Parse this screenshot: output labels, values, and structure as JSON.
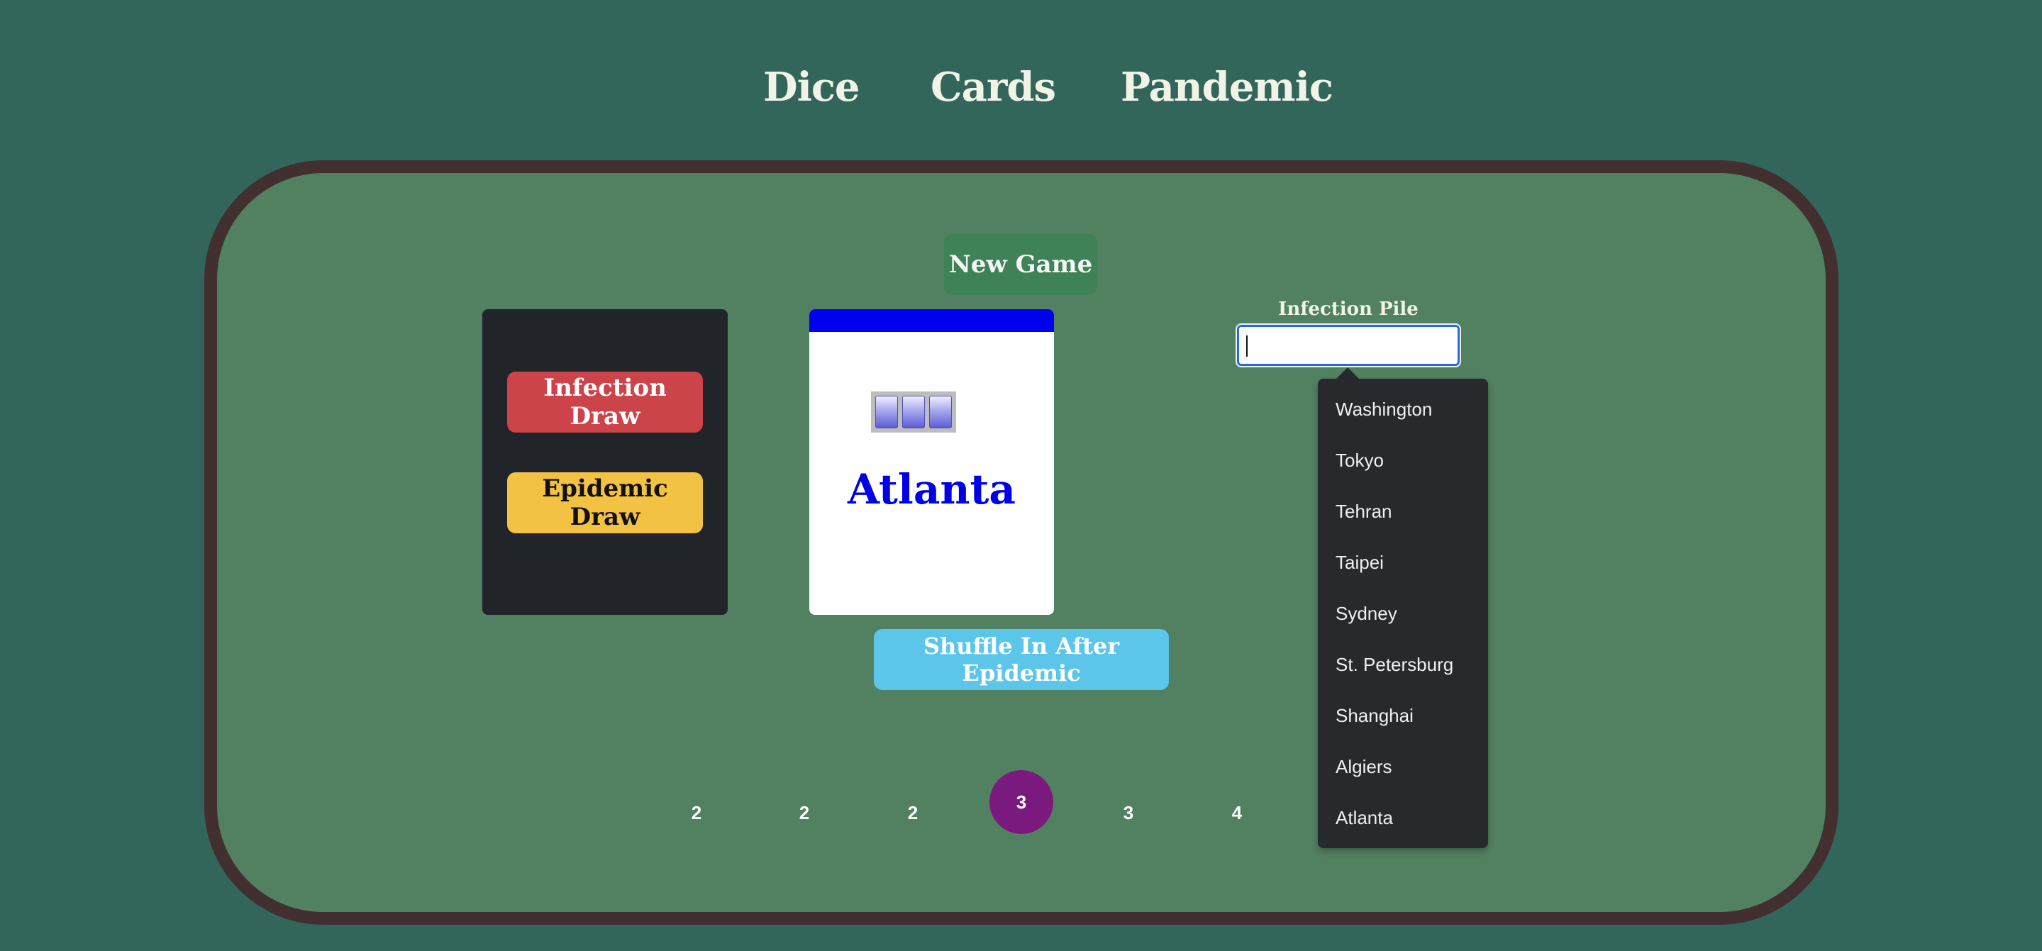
{
  "nav": {
    "items": [
      {
        "label": "Dice"
      },
      {
        "label": "Cards"
      },
      {
        "label": "Pandemic"
      }
    ]
  },
  "controls": {
    "new_game": "New Game",
    "infection_draw": "Infection Draw",
    "epidemic_draw": "Epidemic Draw",
    "shuffle": "Shuffle In After Epidemic"
  },
  "current_card": {
    "city": "Atlanta",
    "color": "#0000ee",
    "cube_count": 3
  },
  "infection_pile": {
    "label": "Infection Pile",
    "value": "",
    "options": [
      "Washington",
      "Tokyo",
      "Tehran",
      "Taipei",
      "Sydney",
      "St. Petersburg",
      "Shanghai",
      "Algiers",
      "Atlanta"
    ]
  },
  "infection_rate": {
    "track": [
      "2",
      "2",
      "2",
      "3",
      "3",
      "4"
    ],
    "current_index": 3
  },
  "colors": {
    "background": "#33665a",
    "table_felt": "#528161",
    "table_border": "#422f2f",
    "infection_draw": "#cc4349",
    "epidemic_draw": "#f4c243",
    "new_game": "#3f8257",
    "shuffle": "#5bc6ea",
    "active_rate": "#7b1a7e"
  }
}
